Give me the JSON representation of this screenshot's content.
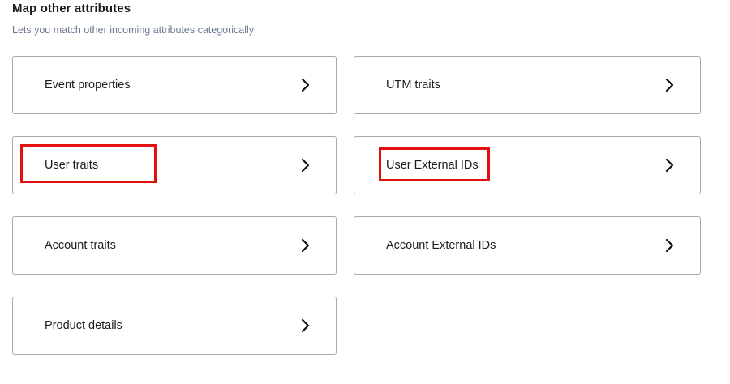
{
  "section": {
    "title": "Map other attributes",
    "subtitle": "Lets you match other incoming attributes categorically"
  },
  "cards": [
    {
      "label": "Event properties",
      "icon": "chevron-right-icon"
    },
    {
      "label": "UTM traits",
      "icon": "chevron-right-icon"
    },
    {
      "label": "User traits",
      "icon": "chevron-right-icon",
      "highlighted": true
    },
    {
      "label": "User External IDs",
      "icon": "chevron-right-icon",
      "highlighted": true
    },
    {
      "label": "Account traits",
      "icon": "chevron-right-icon"
    },
    {
      "label": "Account External IDs",
      "icon": "chevron-right-icon"
    },
    {
      "label": "Product details",
      "icon": "chevron-right-icon"
    }
  ],
  "colors": {
    "highlight": "#e01010",
    "card_border": "#a9a9a9",
    "subtitle": "#6a7890"
  }
}
